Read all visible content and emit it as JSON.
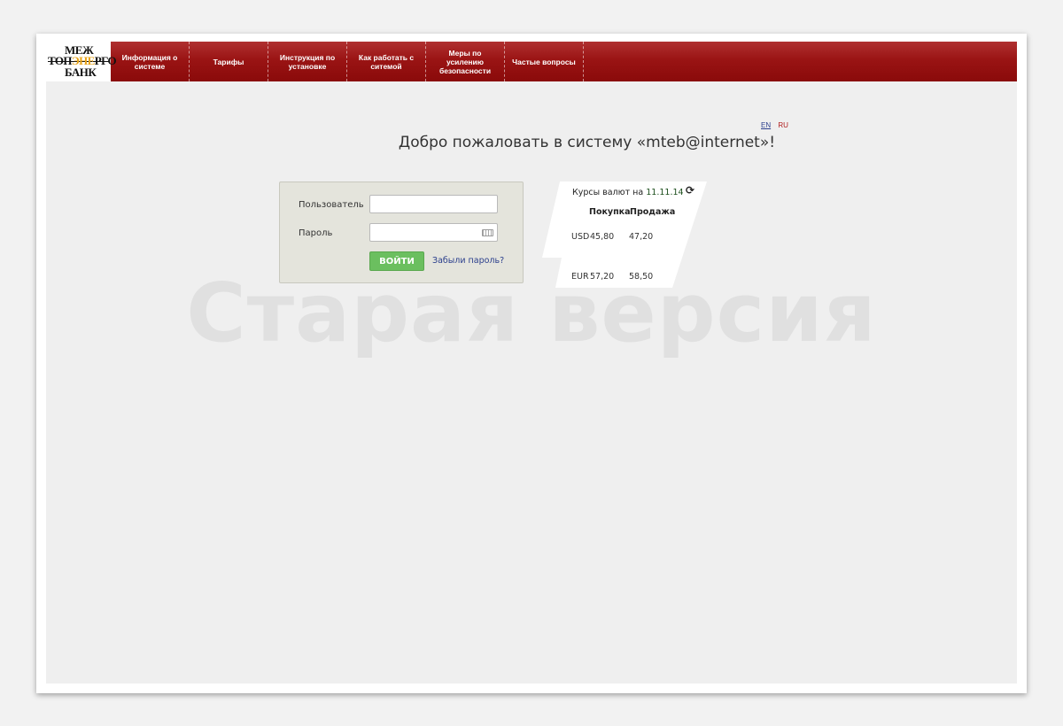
{
  "logo": {
    "line1": "МЕЖ",
    "line2_pre": "ТОП",
    "line2_hl": "ЭНЕ",
    "line2_post": "РГО",
    "line3": "БАНК"
  },
  "nav": {
    "items": [
      {
        "label": "Информация о системе"
      },
      {
        "label": "Тарифы"
      },
      {
        "label": "Инструкция по установке"
      },
      {
        "label": "Как работать с ситемой"
      },
      {
        "label": "Меры по усилению безопасности"
      },
      {
        "label": "Частые вопросы"
      }
    ]
  },
  "languages": {
    "en": "EN",
    "ru": "RU"
  },
  "welcome_text": "Добро пожаловать в систему «mteb@internet»!",
  "login": {
    "user_label": "Пользователь",
    "password_label": "Пароль",
    "user_value": "",
    "password_value": "",
    "submit_label": "ВОЙТИ",
    "forgot_label": "Забыли пароль?"
  },
  "rates": {
    "title": "Курсы валют на",
    "date": "11.11.14",
    "col_buy": "Покупка",
    "col_sell": "Продажа",
    "rows": [
      {
        "currency": "USD",
        "buy": "45,80",
        "sell": "47,20"
      },
      {
        "currency": "EUR",
        "buy": "57,20",
        "sell": "58,50"
      }
    ]
  },
  "watermark": "Старая версия",
  "colors": {
    "header": "#9a1414",
    "button": "#6bbf5f",
    "link": "#2a3e8c",
    "accent_logo": "#e8a317"
  }
}
